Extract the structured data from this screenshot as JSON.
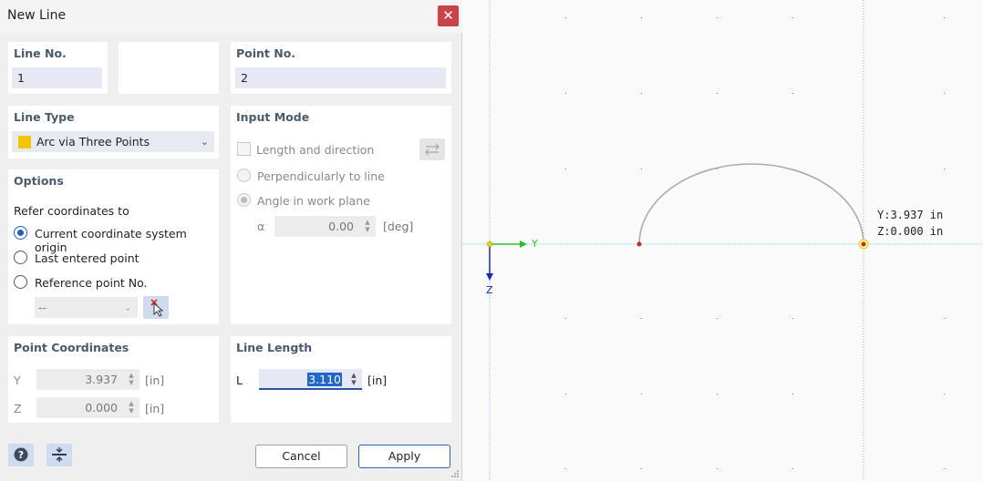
{
  "dialog": {
    "title": "New Line",
    "line_no": {
      "label": "Line No.",
      "value": "1"
    },
    "point_no": {
      "label": "Point No.",
      "value": "2"
    },
    "line_type": {
      "label": "Line Type",
      "selected": "Arc via Three Points",
      "color": "#f5c400"
    },
    "input_mode": {
      "label": "Input Mode",
      "options": [
        "Length and direction",
        "Perpendicularly to line",
        "Angle in work plane"
      ],
      "alpha_label": "α",
      "alpha_value": "0.00",
      "alpha_unit": "[deg]"
    },
    "options": {
      "label": "Options",
      "refer_label": "Refer coordinates to",
      "radios": [
        "Current coordinate system origin",
        "Last entered point",
        "Reference point No."
      ],
      "ref_select": "--"
    },
    "point_coords": {
      "label": "Point Coordinates",
      "y_label": "Y",
      "y_value": "3.937",
      "y_unit": "[in]",
      "z_label": "Z",
      "z_value": "0.000",
      "z_unit": "[in]"
    },
    "line_length": {
      "label": "Line Length",
      "l_label": "L",
      "l_value": "3.110",
      "l_unit": "[in]"
    },
    "buttons": {
      "cancel": "Cancel",
      "apply": "Apply"
    }
  },
  "canvas": {
    "axis_y_label": "Y",
    "axis_z_label": "Z",
    "readout_y": "Y:3.937 in",
    "readout_z": "Z:0.000 in"
  }
}
